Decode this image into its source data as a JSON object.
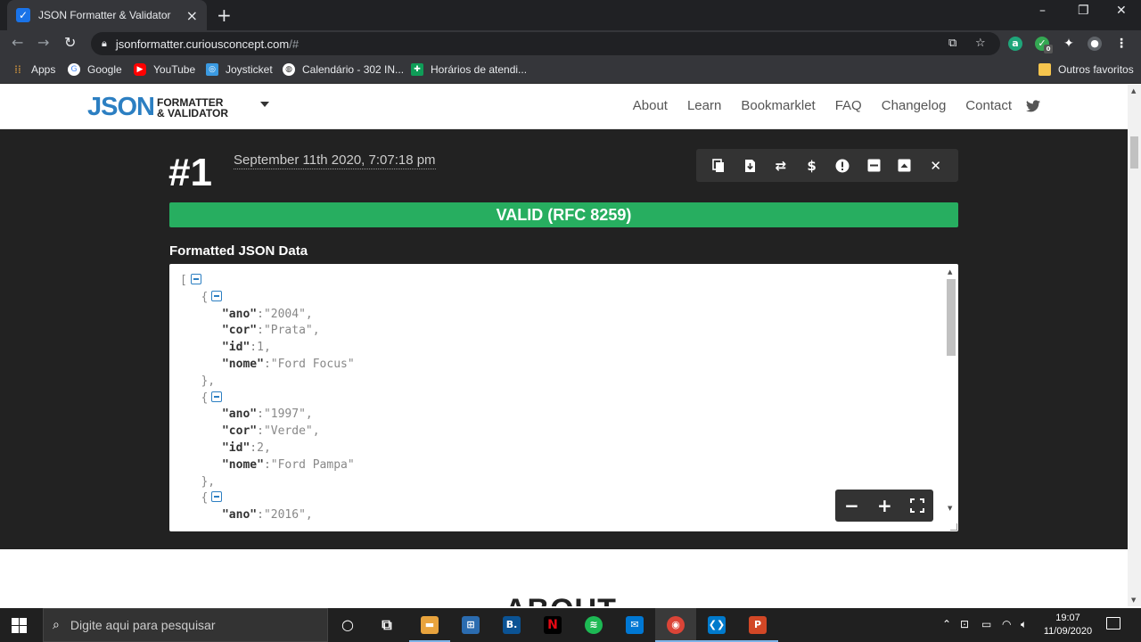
{
  "browser": {
    "tab_title": "JSON Formatter & Validator",
    "url_host": "jsonformatter.curiousconcept.com",
    "url_rest": "/#",
    "bookmarks": [
      "Apps",
      "Google",
      "YouTube",
      "Joysticket",
      "Calendário - 302 IN...",
      "Horários de atendi..."
    ],
    "other_bookmarks": "Outros favoritos",
    "extension_badge": "0"
  },
  "site": {
    "logo_main": "JSON",
    "logo_line1": "FORMATTER",
    "logo_line2": "& VALIDATOR",
    "nav": [
      "About",
      "Learn",
      "Bookmarklet",
      "FAQ",
      "Changelog",
      "Contact"
    ]
  },
  "result": {
    "number": "#1",
    "timestamp": "September 11th 2020, 7:07:18 pm",
    "status": "VALID (RFC 8259)",
    "section_label": "Formatted JSON Data",
    "records": [
      {
        "ano": "\"2004\"",
        "cor": "\"Prata\"",
        "id": "1",
        "nome": "\"Ford Focus\""
      },
      {
        "ano": "\"1997\"",
        "cor": "\"Verde\"",
        "id": "2",
        "nome": "\"Ford Pampa\""
      },
      {
        "ano": "\"2016\""
      }
    ],
    "keys": {
      "ano": "\"ano\"",
      "cor": "\"cor\"",
      "id": "\"id\"",
      "nome": "\"nome\""
    }
  },
  "about_heading": "ABOUT",
  "taskbar": {
    "search_placeholder": "Digite aqui para pesquisar",
    "time": "19:07",
    "date": "11/09/2020"
  },
  "colors": {
    "brand": "#2c7fc2",
    "valid": "#27ae60",
    "dark_bg": "#222222"
  }
}
